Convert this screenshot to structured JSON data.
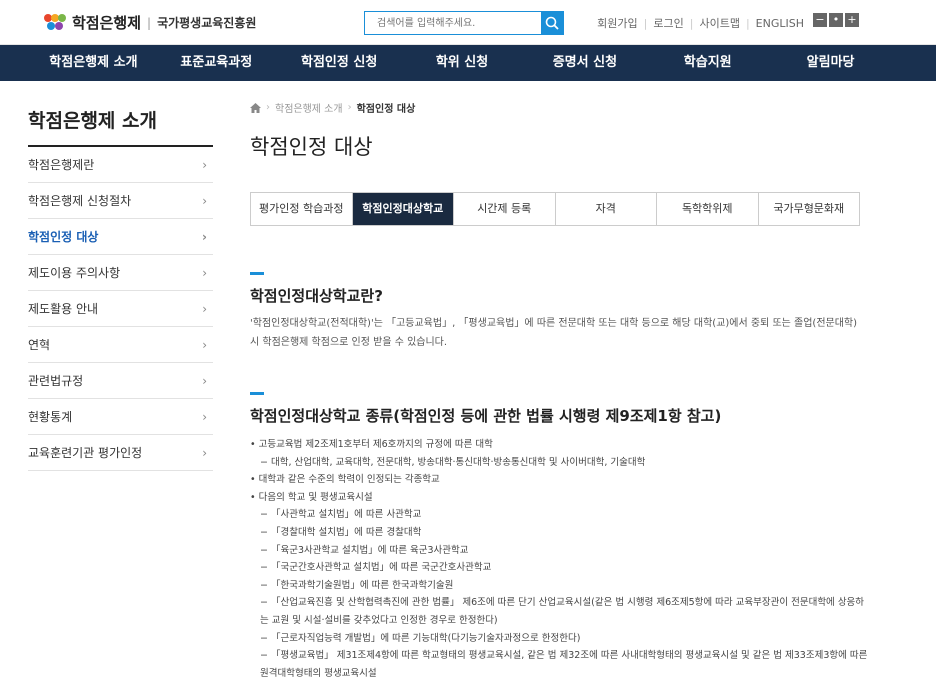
{
  "header": {
    "logo_title": "학점은행제",
    "logo_sep": "|",
    "logo_sub": "국가평생교육진흥원",
    "search_placeholder": "검색어를 입력해주세요.",
    "util": [
      "회원가입",
      "로그인",
      "사이트맵",
      "ENGLISH"
    ],
    "zoom": [
      "−",
      "•",
      "+"
    ]
  },
  "gnb": [
    "학점은행제 소개",
    "표준교육과정",
    "학점인정 신청",
    "학위 신청",
    "증명서 신청",
    "학습지원",
    "알림마당"
  ],
  "sidebar": {
    "title": "학점은행제 소개",
    "items": [
      {
        "label": "학점은행제란"
      },
      {
        "label": "학점은행제 신청절차"
      },
      {
        "label": "학점인정 대상"
      },
      {
        "label": "제도이용 주의사항"
      },
      {
        "label": "제도활용 안내"
      },
      {
        "label": "연혁"
      },
      {
        "label": "관련법규정"
      },
      {
        "label": "현황통계"
      },
      {
        "label": "교육훈련기관 평가인정"
      }
    ],
    "chevron": "›"
  },
  "breadcrumb": [
    "학점은행제 소개",
    "학점인정 대상"
  ],
  "page_title": "학점인정 대상",
  "tabs": [
    "평가인정 학습과정",
    "학점인정대상학교",
    "시간제 등록",
    "자격",
    "독학학위제",
    "국가무형문화재"
  ],
  "section1": {
    "heading": "학점인정대상학교란?",
    "para": "'학점인정대상학교(전적대학)'는 「고등교육법」, 「평생교육법」에 따른 전문대학 또는 대학 등으로 해당 대학(교)에서 중퇴 또는 졸업(전문대학)시 학점은행제 학점으로 인정 받을 수 있습니다."
  },
  "section2": {
    "heading": "학점인정대상학교 종류(학점인정 등에 관한 법률 시행령 제9조제1항 참고)",
    "list": [
      {
        "t": "• 고등교육법 제2조제1호부터 제6호까지의 규정에 따른 대학",
        "lvl": "b"
      },
      {
        "t": "− 대학, 산업대학, 교육대학, 전문대학, 방송대학·통신대학·방송통신대학 및 사이버대학, 기술대학",
        "lvl": "s"
      },
      {
        "t": "• 대학과 같은 수준의 학력이 인정되는 각종학교",
        "lvl": "b"
      },
      {
        "t": "• 다음의 학교 및 평생교육시설",
        "lvl": "b"
      },
      {
        "t": "− 「사관학교 설치법」에 따른 사관학교",
        "lvl": "s"
      },
      {
        "t": "− 「경찰대학 설치법」에 따른 경찰대학",
        "lvl": "s"
      },
      {
        "t": "− 「육군3사관학교 설치법」에 따른 육군3사관학교",
        "lvl": "s"
      },
      {
        "t": "− 「국군간호사관학교 설치법」에 따른 국군간호사관학교",
        "lvl": "s"
      },
      {
        "t": "− 「한국과학기술원법」에 따른 한국과학기술원",
        "lvl": "s"
      },
      {
        "t": "− 「산업교육진흥 및 산학협력촉진에 관한 법률」 제6조에 따른 단기 산업교육시설(같은 법 시행령 제6조제5항에 따라 교육부장관이 전문대학에 상응하는 교원 및 시설·설비를 갖추었다고 인정한 경우로 한정한다)",
        "lvl": "s"
      },
      {
        "t": "− 「근로자직업능력 개발법」에 따른 기능대학(다기능기술자과정으로 한정한다)",
        "lvl": "s"
      },
      {
        "t": "− 「평생교육법」 제31조제4항에 따른 학교형태의 평생교육시설, 같은 법 제32조에 따른 사내대학형태의 평생교육시설 및 같은 법 제33조제3항에 따른 원격대학형태의 평생교육시설",
        "lvl": "s"
      }
    ]
  }
}
